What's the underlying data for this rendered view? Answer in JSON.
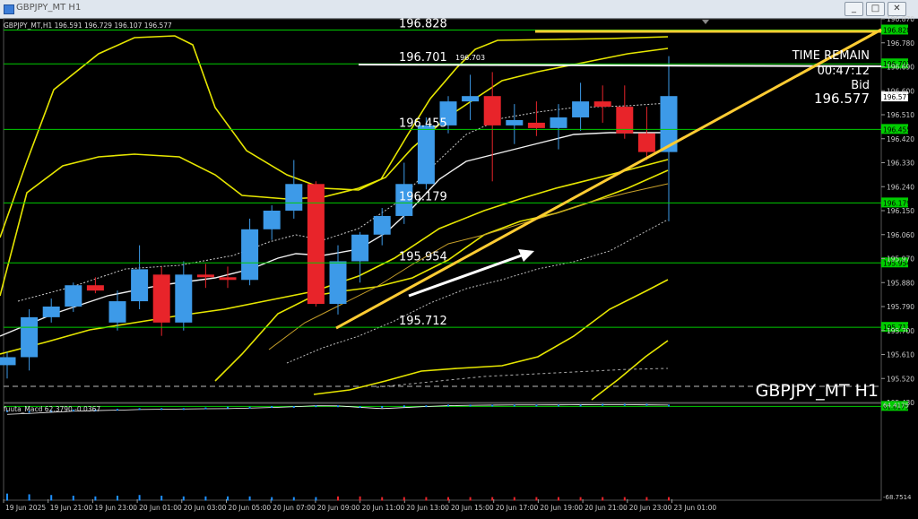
{
  "window": {
    "title": "GBPJPY_MT H1",
    "btn_min": "_",
    "btn_max": "□",
    "btn_close": "✕"
  },
  "colors": {
    "bull": "#3d9ae8",
    "bear": "#e8242a",
    "bands": "#e6e600",
    "trendline": "#ffcc33",
    "hline": "#00cc00",
    "macd": "#ffffff",
    "signal": "#1e90ff"
  },
  "chart_data": [
    {
      "type": "candlestick",
      "header": "GBPJPY_MT,H1  196.591 196.729 196.107 196.577",
      "watermark": "GBPJPY_MT H1",
      "info": {
        "time_remain_label": "TIME REMAIN",
        "time_remain": "00:47:12",
        "bid_label": "Bid",
        "bid": "196.577"
      },
      "ylim": [
        195.45,
        196.87
      ],
      "y_ticks": [
        "196.870",
        "196.780",
        "196.690",
        "196.600",
        "196.510",
        "196.420",
        "196.330",
        "196.240",
        "196.150",
        "196.060",
        "195.970",
        "195.880",
        "195.790",
        "195.700",
        "195.610",
        "195.520",
        "195.430"
      ],
      "x_ticks": [
        "19 Jun 2025",
        "19 Jun 21:00",
        "19 Jun 23:00",
        "20 Jun 01:00",
        "20 Jun 03:00",
        "20 Jun 05:00",
        "20 Jun 07:00",
        "20 Jun 09:00",
        "20 Jun 11:00",
        "20 Jun 13:00",
        "20 Jun 15:00",
        "20 Jun 17:00",
        "20 Jun 19:00",
        "20 Jun 21:00",
        "20 Jun 23:00",
        "23 Jun 01:00"
      ],
      "current_price": "196.577",
      "levels": [
        {
          "label": "196.828",
          "tag": "196.828",
          "value": 196.828
        },
        {
          "label": "196.701",
          "tag": "196.701",
          "extra": "196.703",
          "value": 196.701
        },
        {
          "label": "196.455",
          "tag": "196.455",
          "value": 196.455
        },
        {
          "label": "196.179",
          "tag": "196.179",
          "value": 196.179
        },
        {
          "label": "195.954",
          "tag": "195.954",
          "value": 195.954
        },
        {
          "label": "195.712",
          "tag": "195.712",
          "value": 195.712
        }
      ],
      "candles": [
        {
          "o": 195.57,
          "h": 195.62,
          "l": 195.52,
          "c": 195.6
        },
        {
          "o": 195.6,
          "h": 195.78,
          "l": 195.55,
          "c": 195.75
        },
        {
          "o": 195.75,
          "h": 195.82,
          "l": 195.73,
          "c": 195.79
        },
        {
          "o": 195.79,
          "h": 195.88,
          "l": 195.77,
          "c": 195.87
        },
        {
          "o": 195.87,
          "h": 195.9,
          "l": 195.84,
          "c": 195.85
        },
        {
          "o": 195.73,
          "h": 195.85,
          "l": 195.7,
          "c": 195.81
        },
        {
          "o": 195.81,
          "h": 196.02,
          "l": 195.78,
          "c": 195.93
        },
        {
          "o": 195.91,
          "h": 195.94,
          "l": 195.68,
          "c": 195.73
        },
        {
          "o": 195.73,
          "h": 195.96,
          "l": 195.7,
          "c": 195.91
        },
        {
          "o": 195.91,
          "h": 195.95,
          "l": 195.86,
          "c": 195.9
        },
        {
          "o": 195.9,
          "h": 195.94,
          "l": 195.86,
          "c": 195.89
        },
        {
          "o": 195.89,
          "h": 196.12,
          "l": 195.87,
          "c": 196.08
        },
        {
          "o": 196.08,
          "h": 196.17,
          "l": 196.04,
          "c": 196.15
        },
        {
          "o": 196.15,
          "h": 196.34,
          "l": 196.12,
          "c": 196.25
        },
        {
          "o": 196.25,
          "h": 196.26,
          "l": 195.79,
          "c": 195.8
        },
        {
          "o": 195.8,
          "h": 196.02,
          "l": 195.76,
          "c": 195.96
        },
        {
          "o": 195.96,
          "h": 196.07,
          "l": 195.88,
          "c": 196.06
        },
        {
          "o": 196.06,
          "h": 196.16,
          "l": 196.02,
          "c": 196.13
        },
        {
          "o": 196.13,
          "h": 196.33,
          "l": 196.1,
          "c": 196.25
        },
        {
          "o": 196.25,
          "h": 196.5,
          "l": 196.23,
          "c": 196.47
        },
        {
          "o": 196.47,
          "h": 196.58,
          "l": 196.44,
          "c": 196.56
        },
        {
          "o": 196.56,
          "h": 196.66,
          "l": 196.49,
          "c": 196.58
        },
        {
          "o": 196.58,
          "h": 196.67,
          "l": 196.26,
          "c": 196.47
        },
        {
          "o": 196.47,
          "h": 196.55,
          "l": 196.4,
          "c": 196.49
        },
        {
          "o": 196.48,
          "h": 196.56,
          "l": 196.43,
          "c": 196.46
        },
        {
          "o": 196.46,
          "h": 196.55,
          "l": 196.38,
          "c": 196.5
        },
        {
          "o": 196.5,
          "h": 196.63,
          "l": 196.45,
          "c": 196.56
        },
        {
          "o": 196.56,
          "h": 196.62,
          "l": 196.48,
          "c": 196.54
        },
        {
          "o": 196.54,
          "h": 196.62,
          "l": 196.42,
          "c": 196.44
        },
        {
          "o": 196.44,
          "h": 196.54,
          "l": 196.34,
          "c": 196.37
        },
        {
          "o": 196.37,
          "h": 196.73,
          "l": 196.11,
          "c": 196.58
        }
      ]
    },
    {
      "type": "line",
      "header": "fuuta_Macd 62.3790 -0.0367",
      "y_ticks": [
        "64.4175",
        "61.8179",
        "-68.7514"
      ],
      "series": [
        {
          "values": [
            50.5,
            51.8,
            53.4,
            54.9,
            55.8,
            56.4,
            57.3,
            57.6,
            58.1,
            58.4,
            58.6,
            59.4,
            60.2,
            61.3,
            62.7,
            62.5,
            60.4,
            58.7,
            60.1,
            61.6,
            62.8,
            63.4,
            63.6,
            63.8,
            63.8,
            63.9,
            64.1,
            64.2,
            64.2,
            63.9,
            63.7
          ]
        },
        {
          "values": [
            55,
            54,
            55,
            56,
            56,
            57,
            58,
            58,
            58,
            59,
            60,
            60,
            61,
            61,
            62,
            62,
            61,
            61,
            62,
            62,
            63,
            63,
            63,
            63,
            63,
            63,
            63,
            64,
            64,
            64,
            63
          ]
        },
        {
          "values": [
            -62,
            -63,
            -64,
            -65,
            -66,
            -65,
            -64,
            -65,
            -66,
            -66,
            -66,
            -66,
            -67,
            -67,
            -67,
            -66,
            -66,
            -67,
            -67,
            -67,
            -67,
            -67,
            -67,
            -67,
            -67,
            -67,
            -67,
            -67,
            -67,
            -67,
            -67
          ]
        }
      ]
    }
  ]
}
